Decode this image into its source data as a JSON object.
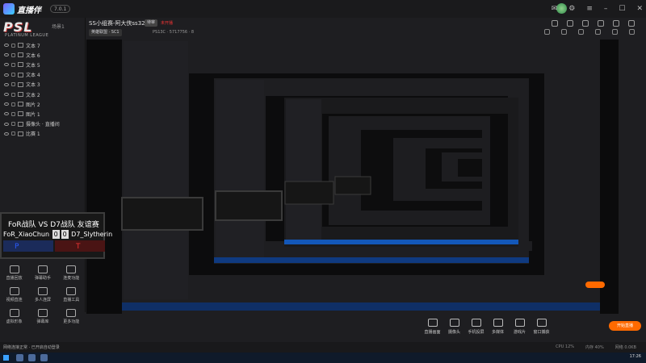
{
  "app": {
    "name": "直播伴侣",
    "version": "7.0.1",
    "title": "SS小组赛-阿大侠ss3277",
    "tag": "待审",
    "status": "未开播",
    "category": "英雄联盟 · SC1",
    "meta": "PS13C · 5717756 · 8"
  },
  "sidebar": {
    "logo": "PSL",
    "logo_sub": "PLATINUM LEAGUE",
    "scene": "场景1",
    "layers": [
      "文本 7",
      "文本 6",
      "文本 5",
      "文本 4",
      "文本 3",
      "文本 2",
      "图片 2",
      "图片 1",
      "摄像头 · 直播间",
      "比赛 1"
    ],
    "tools": [
      {
        "label": "直播回放"
      },
      {
        "label": "弹幕助手"
      },
      {
        "label": "连麦功能"
      },
      {
        "label": "视频直连"
      },
      {
        "label": "多人连屏"
      },
      {
        "label": "直播工具"
      },
      {
        "label": "虚拟形象"
      },
      {
        "label": "弹幕库"
      },
      {
        "label": "更多功能"
      }
    ]
  },
  "overlay": {
    "title": "FoR战队 VS D7战队  友谊赛",
    "left_team": "FoR_XiaoChun",
    "score_left": "0",
    "score_right": "0",
    "right_team": "D7_Slytherin",
    "left_side": "P",
    "right_side": "T"
  },
  "bottom": {
    "tools": [
      "直播画面",
      "摄像头",
      "手机投屏",
      "多媒体",
      "游戏片",
      "窗口捕获"
    ],
    "start_label": "开始直播",
    "status_left": "网络连接正常 · 已开启自动登录",
    "status_right": [
      "CPU 12%",
      "内存 40%",
      "网络 0.0KB"
    ]
  },
  "taskbar": {
    "clock": "17:26"
  }
}
